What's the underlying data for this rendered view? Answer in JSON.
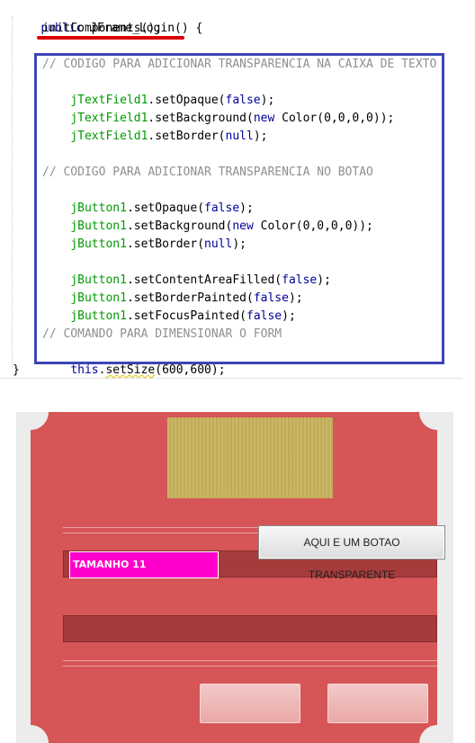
{
  "code": {
    "method_sig": "public JFrame_Login() {",
    "init_call": "initComponents();",
    "comment_textfield": "// CODIGO PARA ADICIONAR TRANSPARENCIA NA CAIXA DE TEXTO",
    "tf_line1": [
      "jTextField1",
      ".setOpaque(",
      "false",
      ");"
    ],
    "tf_line2": [
      "jTextField1",
      ".setBackground(",
      "new",
      " Color(0,0,0,0));"
    ],
    "tf_line3": [
      "jTextField1",
      ".setBorder(",
      "null",
      ");"
    ],
    "comment_button": "// CODIGO PARA ADICIONAR TRANSPARENCIA NO BOTAO",
    "bt_line1": [
      "jButton1",
      ".setOpaque(",
      "false",
      ");"
    ],
    "bt_line2": [
      "jButton1",
      ".setBackground(",
      "new",
      " Color(0,0,0,0));"
    ],
    "bt_line3": [
      "jButton1",
      ".setBorder(",
      "null",
      ");"
    ],
    "bt_line4": [
      "jButton1",
      ".setContentAreaFilled(",
      "false",
      ");"
    ],
    "bt_line5": [
      "jButton1",
      ".setBorderPainted(",
      "false",
      ");"
    ],
    "bt_line6": [
      "jButton1",
      ".setFocusPainted(",
      "false",
      ");"
    ],
    "comment_size": "// COMANDO PARA DIMENSIONAR O FORM",
    "size_line": [
      "this",
      ".",
      "setSize",
      "(600,600);"
    ],
    "closing_brace": "}"
  },
  "preview": {
    "text_field_label": "TAMANHO 11",
    "transparent_button_label": "AQUI E UM BOTAO TRANSPARENTE"
  },
  "colors": {
    "keyword": "#00009b",
    "field": "#009900",
    "comment": "#8f8f8f",
    "highlight_box": "#3b46b6",
    "underline": "#dd0000",
    "frame_red": "#d65556",
    "magenta": "#ff00cc"
  }
}
